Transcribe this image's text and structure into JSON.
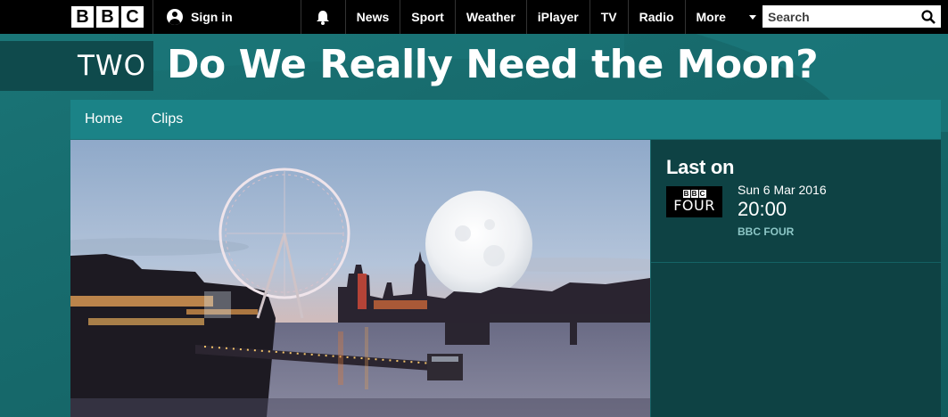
{
  "topbar": {
    "logo_letters": [
      "B",
      "B",
      "C"
    ],
    "signin_label": "Sign in",
    "nav": [
      "News",
      "Sport",
      "Weather",
      "iPlayer",
      "TV",
      "Radio"
    ],
    "more_label": "More",
    "search_placeholder": "Search"
  },
  "header": {
    "channel_logo": "TWO",
    "title": "Do We Really Need the Moon?"
  },
  "subnav": {
    "items": [
      "Home",
      "Clips"
    ]
  },
  "last_on": {
    "heading": "Last on",
    "channel_logo_top": [
      "B",
      "B",
      "C"
    ],
    "channel_logo_text": "FOUR",
    "date": "Sun 6 Mar 2016",
    "time": "20:00",
    "channel": "BBC FOUR"
  },
  "colors": {
    "page_bg": "#17696b",
    "nav_bg": "#1b8387",
    "panel_bg": "#0e4244",
    "channel_text": "#8cc6c6"
  }
}
